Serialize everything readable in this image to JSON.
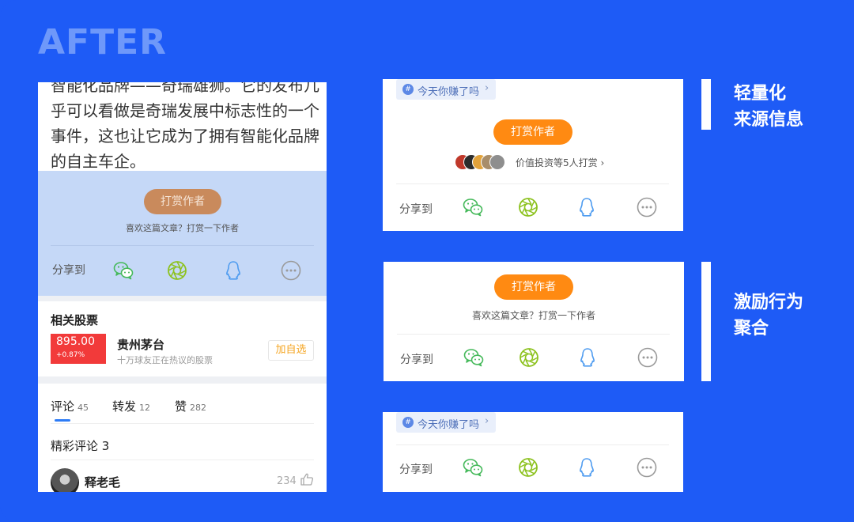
{
  "title": "AFTER",
  "left_panel": {
    "article_text": "智能化品牌——奇瑞雄狮。它的发布几乎可以看做是奇瑞发展中标志性的一个事件，这也让它成为了拥有智能化品牌的自主车企。",
    "reward_button": "打赏作者",
    "reward_hint": "喜欢这篇文章？打赏一下作者",
    "share_label": "分享到",
    "related_stocks_title": "相关股票",
    "stock": {
      "price": "895.00",
      "change": "+0.87%",
      "name": "贵州茅台",
      "desc": "十万球友正在热议的股票",
      "watch_button": "加自选"
    },
    "tabs": [
      {
        "label": "评论",
        "count": "45"
      },
      {
        "label": "转发",
        "count": "12"
      },
      {
        "label": "赞",
        "count": "282"
      }
    ],
    "hot_comments_title": "精彩评论 3",
    "comment": {
      "author": "释老毛",
      "likes": "234"
    }
  },
  "card1": {
    "source_tag": "今天你赚了吗",
    "reward_button": "打赏作者",
    "supporters_text": "价值投资等5人打赏",
    "share_label": "分享到"
  },
  "card2": {
    "reward_button": "打赏作者",
    "reward_hint": "喜欢这篇文章？打赏一下作者",
    "share_label": "分享到"
  },
  "card3": {
    "source_tag": "今天你赚了吗",
    "share_label": "分享到"
  },
  "labels": {
    "label1": "轻量化\n来源信息",
    "label2": "激励行为\n聚合"
  },
  "icons": [
    "wechat-icon",
    "moments-icon",
    "qq-icon",
    "more-icon",
    "like-icon",
    "hash-icon"
  ],
  "colors": {
    "background": "#1E5BF6",
    "accent_orange": "#FF8A12",
    "stock_red": "#F23A3A",
    "wechat_green": "#45B95A",
    "moments_green": "#8DC21F",
    "qq_blue": "#4D9BF0"
  }
}
